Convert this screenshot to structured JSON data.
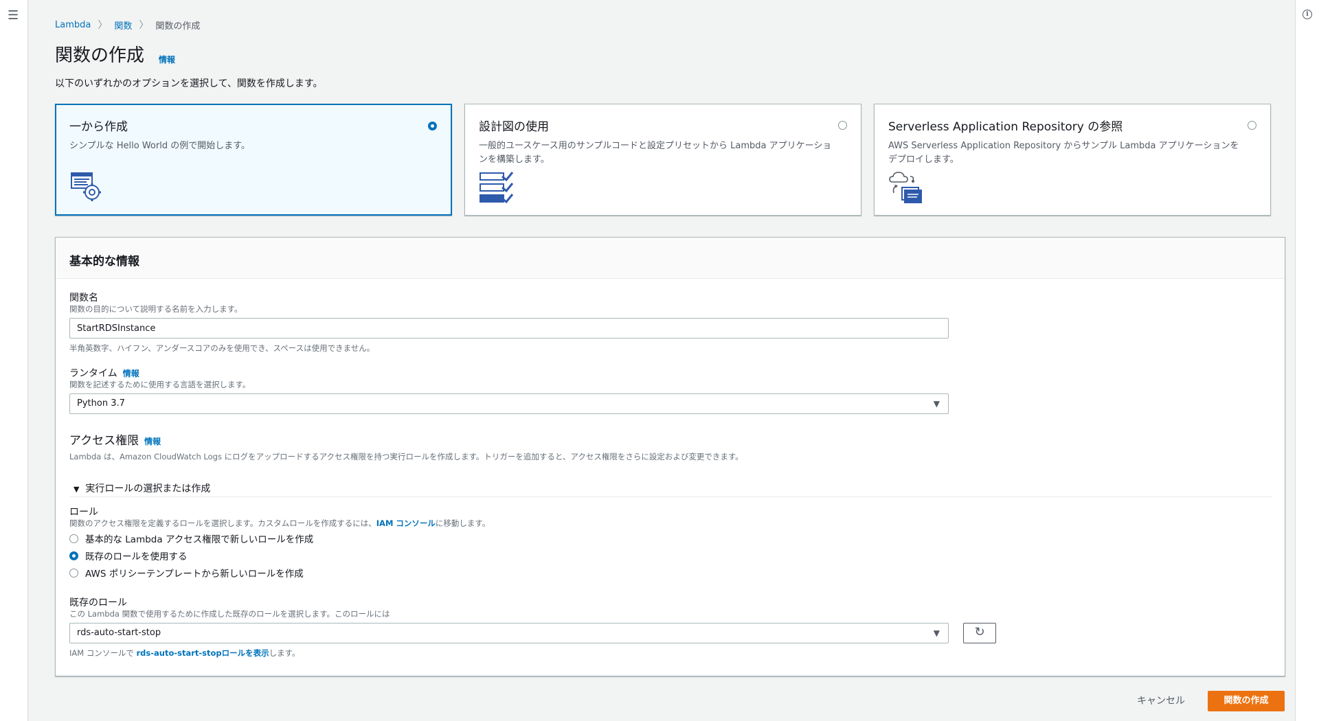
{
  "breadcrumb": {
    "root": "Lambda",
    "functions": "関数",
    "current": "関数の作成"
  },
  "page": {
    "title": "関数の作成",
    "info": "情報",
    "description": "以下のいずれかのオプションを選択して、関数を作成します。"
  },
  "options": [
    {
      "title": "一から作成",
      "desc": "シンプルな Hello World の例で開始します。",
      "selected": true,
      "icon": "function-gear-icon"
    },
    {
      "title": "設計図の使用",
      "desc": "一般的ユースケース用のサンプルコードと設定プリセットから Lambda アプリケーションを構築します。",
      "selected": false,
      "icon": "blueprint-checklist-icon"
    },
    {
      "title": "Serverless Application Repository の参照",
      "desc": "AWS Serverless Application Repository からサンプル Lambda アプリケーションをデプロイします。",
      "selected": false,
      "icon": "cloud-repository-icon"
    }
  ],
  "basic": {
    "header": "基本的な情報",
    "name_label": "関数名",
    "name_hint": "関数の目的について説明する名前を入力します。",
    "name_value": "StartRDSInstance",
    "name_rule": "半角英数字、ハイフン、アンダースコアのみを使用でき、スペースは使用できません。",
    "runtime_label": "ランタイム",
    "runtime_info": "情報",
    "runtime_hint": "関数を記述するために使用する言語を選択します。",
    "runtime_value": "Python 3.7"
  },
  "access": {
    "title": "アクセス権限",
    "info": "情報",
    "desc": "Lambda は、Amazon CloudWatch Logs にログをアップロードするアクセス権限を持つ実行ロールを作成します。トリガーを追加すると、アクセス権限をさらに設定および変更できます。",
    "expander": "実行ロールの選択または作成",
    "role_label": "ロール",
    "role_hint_pre": "関数のアクセス権限を定義するロールを選択します。カスタムロールを作成するには、",
    "role_hint_link": "IAM コンソール",
    "role_hint_post": "に移動します。",
    "role_options": [
      {
        "label": "基本的な Lambda アクセス権限で新しいロールを作成",
        "selected": false
      },
      {
        "label": "既存のロールを使用する",
        "selected": true
      },
      {
        "label": "AWS ポリシーテンプレートから新しいロールを作成",
        "selected": false
      }
    ],
    "existing_label": "既存のロール",
    "existing_hint": "この Lambda 関数で使用するために作成した既存のロールを選択します。このロールには",
    "existing_value": "rds-auto-start-stop",
    "iam_pre": "IAM コンソールで ",
    "iam_link": "rds-auto-start-stopロールを表示",
    "iam_post": "します。"
  },
  "footer": {
    "cancel": "キャンセル",
    "create": "関数の作成"
  },
  "colors": {
    "accent": "#0073bb",
    "primary_button": "#ec7211"
  }
}
